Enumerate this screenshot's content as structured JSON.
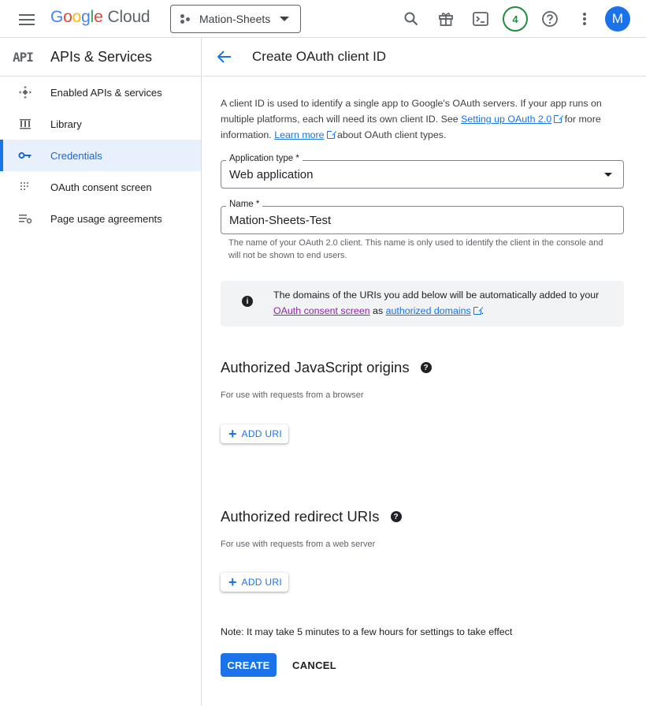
{
  "topbar": {
    "logo_letters": [
      "G",
      "o",
      "o",
      "g",
      "l",
      "e"
    ],
    "logo_cloud": "Cloud",
    "project_name": "Mation-Sheets",
    "notifications_count": "4",
    "avatar_initial": "M"
  },
  "sidebar": {
    "api_logo": "API",
    "title": "APIs & Services",
    "items": [
      {
        "label": "Enabled APIs & services",
        "icon": "enabled-apis-icon"
      },
      {
        "label": "Library",
        "icon": "library-icon"
      },
      {
        "label": "Credentials",
        "icon": "key-icon",
        "active": true
      },
      {
        "label": "OAuth consent screen",
        "icon": "consent-icon"
      },
      {
        "label": "Page usage agreements",
        "icon": "agreements-icon"
      }
    ]
  },
  "main": {
    "title": "Create OAuth client ID",
    "intro": {
      "text1": "A client ID is used to identify a single app to Google's OAuth servers. If your app runs on multiple platforms, each will need its own client ID. See ",
      "link1": "Setting up OAuth 2.0",
      "text2": " for more information. ",
      "link2": "Learn more",
      "text3": " about OAuth client types."
    },
    "application_type": {
      "label": "Application type *",
      "value": "Web application"
    },
    "name_field": {
      "label": "Name *",
      "value": "Mation-Sheets-Test",
      "hint": "The name of your OAuth 2.0 client. This name is only used to identify the client in the console and will not be shown to end users."
    },
    "info": {
      "text1": "The domains of the URIs you add below will be automatically added to your ",
      "link1": "OAuth consent screen",
      "text2": " as ",
      "link2": "authorized domains",
      "text3": "."
    },
    "js_origins": {
      "title": "Authorized JavaScript origins",
      "subtitle": "For use with requests from a browser",
      "button": "ADD URI"
    },
    "redirect_uris": {
      "title": "Authorized redirect URIs",
      "subtitle": "For use with requests from a web server",
      "button": "ADD URI"
    },
    "note": "Note: It may take 5 minutes to a few hours for settings to take effect",
    "create_label": "CREATE",
    "cancel_label": "CANCEL"
  },
  "colors": {
    "accent": "#1a73e8",
    "active_bg": "#e8f0fe",
    "visited_link": "#8e24aa",
    "badge_green": "#1e8e3e"
  }
}
